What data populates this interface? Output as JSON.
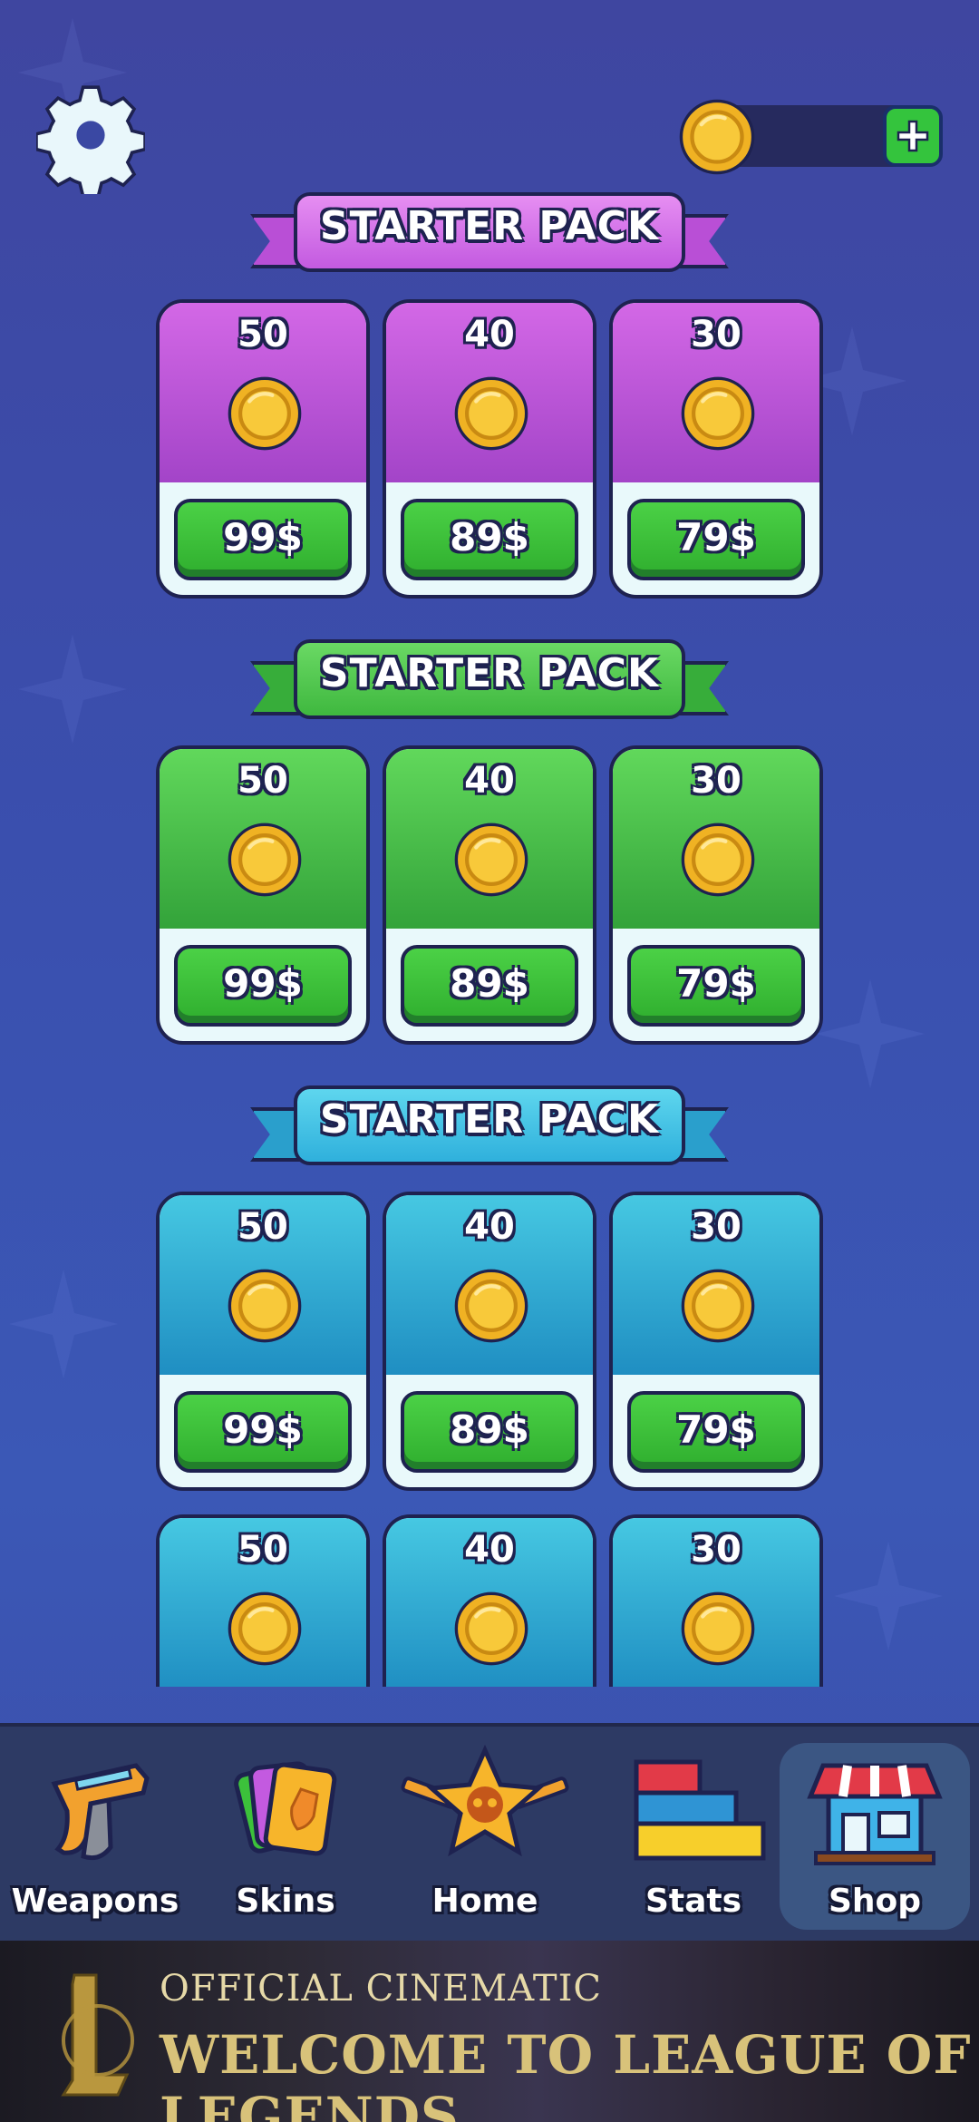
{
  "header": {
    "settings_icon": "gear-icon",
    "coin_icon": "coin-icon",
    "add_coins_icon": "plus-icon",
    "coin_balance": ""
  },
  "packs": [
    {
      "title": "STARTER PACK",
      "theme": "purple",
      "theme_color": "#c35ae0",
      "offers": [
        {
          "quantity": "50",
          "price": "99$"
        },
        {
          "quantity": "40",
          "price": "89$"
        },
        {
          "quantity": "30",
          "price": "79$"
        }
      ]
    },
    {
      "title": "STARTER PACK",
      "theme": "green",
      "theme_color": "#44c043",
      "offers": [
        {
          "quantity": "50",
          "price": "99$"
        },
        {
          "quantity": "40",
          "price": "89$"
        },
        {
          "quantity": "30",
          "price": "79$"
        }
      ]
    },
    {
      "title": "STARTER PACK",
      "theme": "blue",
      "theme_color": "#35b6dc",
      "offers": [
        {
          "quantity": "50",
          "price": "99$"
        },
        {
          "quantity": "40",
          "price": "89$"
        },
        {
          "quantity": "30",
          "price": "79$"
        }
      ]
    },
    {
      "title": "",
      "theme": "blue",
      "theme_color": "#35b6dc",
      "offers": [
        {
          "quantity": "50"
        },
        {
          "quantity": "40"
        },
        {
          "quantity": "30"
        }
      ]
    }
  ],
  "nav": {
    "items": [
      {
        "label": "Weapons",
        "icon": "pistol-icon"
      },
      {
        "label": "Skins",
        "icon": "cards-icon"
      },
      {
        "label": "Home",
        "icon": "skull-star-icon"
      },
      {
        "label": "Stats",
        "icon": "bars-icon"
      },
      {
        "label": "Shop",
        "icon": "shop-icon"
      }
    ],
    "active": "Shop"
  },
  "ad": {
    "line1": "OFFICIAL CINEMATIC",
    "line2": "WELCOME TO LEAGUE OF LEGENDS"
  },
  "colors": {
    "background": "#3d4aa8",
    "buy_button": "#3cc13b",
    "nav_bg": "#2d3a64",
    "coin": "#f2b92a"
  }
}
